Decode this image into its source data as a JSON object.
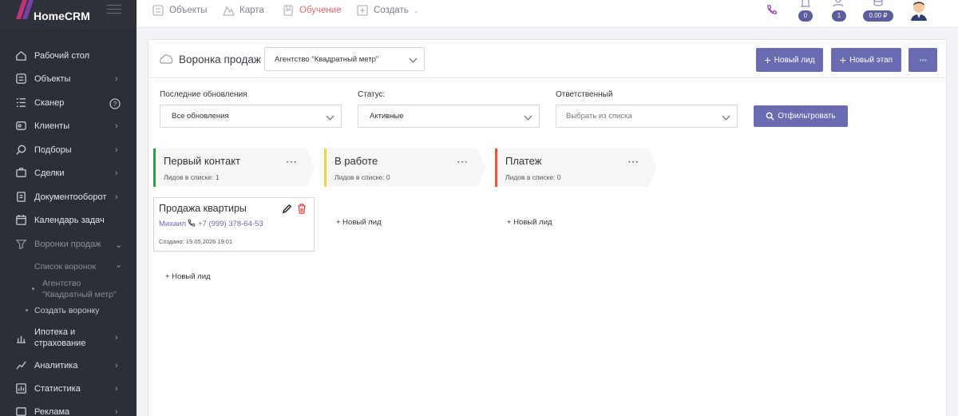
{
  "app": {
    "logo": "HomeCRM"
  },
  "sidebar": {
    "items": [
      {
        "label": "Рабочий стол",
        "icon": "dashboard-icon"
      },
      {
        "label": "Объекты",
        "icon": "objects-icon"
      },
      {
        "label": "Сканер",
        "icon": "scanner-icon"
      },
      {
        "label": "Клиенты",
        "icon": "clients-icon"
      },
      {
        "label": "Подборы",
        "icon": "search-icon"
      },
      {
        "label": "Сделки",
        "icon": "deals-icon"
      },
      {
        "label": "Документооборот",
        "icon": "documents-icon"
      },
      {
        "label": "Календарь задач",
        "icon": "calendar-icon"
      },
      {
        "label": "Воронки продаж",
        "icon": "funnel-icon"
      },
      {
        "label": "Ипотека и страхование",
        "icon": "mortgage-icon"
      },
      {
        "label": "Аналитика",
        "icon": "analytics-icon"
      },
      {
        "label": "Статистика",
        "icon": "statistics-icon"
      },
      {
        "label": "Реклама",
        "icon": "ads-icon"
      }
    ],
    "sub": {
      "funnel_list": "Список воронок",
      "agency_line1": "Агентство",
      "agency_line2": "\"Квадратный метр\"",
      "create_funnel": "Создать воронку"
    },
    "mortgage_line1": "Ипотека и",
    "mortgage_line2": "страхование"
  },
  "topnav": {
    "objects": "Объекты",
    "map": "Карта",
    "training": "Обучение",
    "create": "Создать",
    "notifications_count": "0",
    "users_count": "1",
    "balance": "0.00 ₽"
  },
  "funnel": {
    "title": "Воронка продаж",
    "selected": "Агентство \"Квадратный метр\"",
    "new_lead_btn": "Новый лид",
    "new_stage_btn": "Новый этап",
    "more_btn": "◦◦◦"
  },
  "filters": {
    "updates_label": "Последние обновления",
    "updates_value": "Все обновления",
    "status_label": "Статус:",
    "status_value": "Активные",
    "responsible_label": "Ответственный",
    "responsible_placeholder": "Выбрать из списка",
    "filter_btn": "Отфильтровать"
  },
  "stages": [
    {
      "name": "Первый контакт",
      "count": "Лидов в списке: 1",
      "color": "#2e9e47"
    },
    {
      "name": "В работе",
      "count": "Лидов в списке: 0",
      "color": "#f2d24b"
    },
    {
      "name": "Платеж",
      "count": "Лидов в списке: 0",
      "color": "#e8553a"
    }
  ],
  "card": {
    "title": "Продажа квартиры",
    "contact": "Михаил",
    "phone": "+7 (999) 378-64-53",
    "created": "Создано: 19.05.2026 19:01"
  },
  "new_lead_link": "+ Новый лид"
}
